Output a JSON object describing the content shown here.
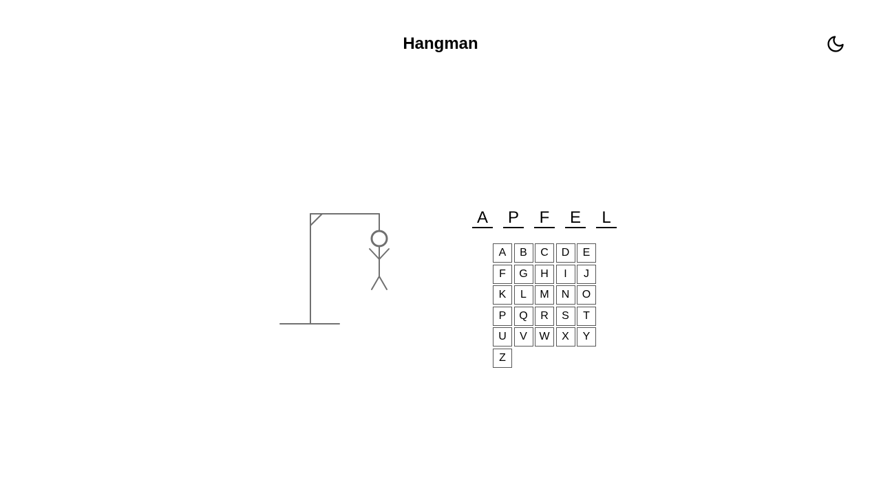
{
  "header": {
    "title": "Hangman",
    "theme_icon": "moon-icon"
  },
  "word": {
    "letters": [
      "A",
      "P",
      "F",
      "E",
      "L"
    ]
  },
  "keyboard": {
    "keys": [
      "A",
      "B",
      "C",
      "D",
      "E",
      "F",
      "G",
      "H",
      "I",
      "J",
      "K",
      "L",
      "M",
      "N",
      "O",
      "P",
      "Q",
      "R",
      "S",
      "T",
      "U",
      "V",
      "W",
      "X",
      "Y",
      "Z"
    ]
  },
  "colors": {
    "drawing": "#707070",
    "text": "#000000",
    "key_border": "#555555",
    "background": "#ffffff"
  }
}
